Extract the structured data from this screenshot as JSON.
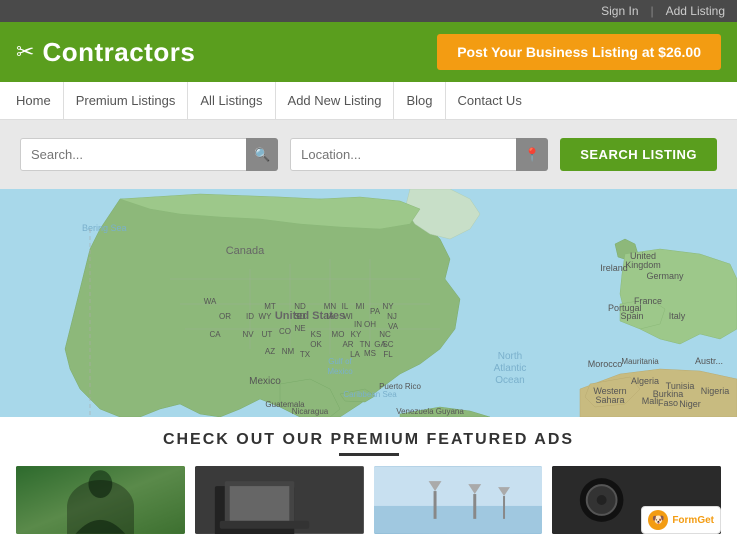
{
  "topbar": {
    "signin_label": "Sign In",
    "addlisting_label": "Add Listing"
  },
  "header": {
    "logo_icon": "✂",
    "logo_text": "Contractors",
    "post_btn_label": "Post Your Business Listing at $26.00"
  },
  "nav": {
    "items": [
      {
        "label": "Home",
        "id": "home"
      },
      {
        "label": "Premium Listings",
        "id": "premium-listings"
      },
      {
        "label": "All Listings",
        "id": "all-listings"
      },
      {
        "label": "Add New Listing",
        "id": "add-new-listing"
      },
      {
        "label": "Blog",
        "id": "blog"
      },
      {
        "label": "Contact Us",
        "id": "contact-us"
      }
    ]
  },
  "search": {
    "keyword_placeholder": "Search...",
    "location_placeholder": "Location...",
    "search_btn_label": "SEARCH LISTING"
  },
  "featured": {
    "title": "CHECK OUT OUR PREMIUM FEATURED ADS"
  },
  "formget": {
    "label": "FormGet"
  }
}
